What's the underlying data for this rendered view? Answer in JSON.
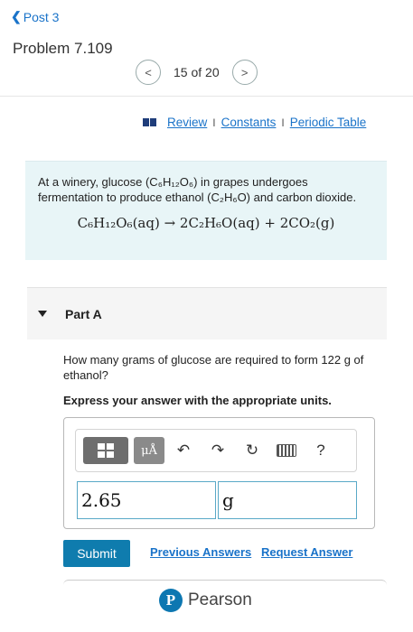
{
  "nav": {
    "back_chevron": "❮",
    "back_label": "Post 3"
  },
  "problem": {
    "title": "Problem 7.109"
  },
  "pager": {
    "prev": "<",
    "text": "15 of 20",
    "next": ">"
  },
  "resources": {
    "review": "Review",
    "separator": "I",
    "constants": "Constants",
    "periodic_table": "Periodic Table"
  },
  "intro": {
    "text": "At a winery, glucose (C₆H₁₂O₆) in grapes undergoes fermentation to produce ethanol (C₂H₆O) and carbon dioxide.",
    "equation": "C₆H₁₂O₆(aq) → 2C₂H₆O(aq) + 2CO₂(g)"
  },
  "part": {
    "label": "Part A"
  },
  "question": {
    "text": "How many grams of glucose are required to form 122 g of ethanol?",
    "instruction": "Express your answer with the appropriate units."
  },
  "toolbar": {
    "templates_icon": "templates-icon",
    "units_label": "μÅ",
    "undo": "↶",
    "redo": "↷",
    "reset": "↻",
    "keyboard_icon": "keyboard-icon",
    "help": "?"
  },
  "answer": {
    "value": "2.65",
    "unit": "g"
  },
  "actions": {
    "submit": "Submit",
    "previous_answers": "Previous Answers",
    "request_answer": "Request Answer"
  },
  "footer": {
    "logo_letter": "P",
    "brand": "Pearson"
  },
  "colors": {
    "link": "#1a73c9",
    "submit": "#0f7cae",
    "intro_bg": "#e8f5f7",
    "input_border": "#5aa9c7"
  }
}
